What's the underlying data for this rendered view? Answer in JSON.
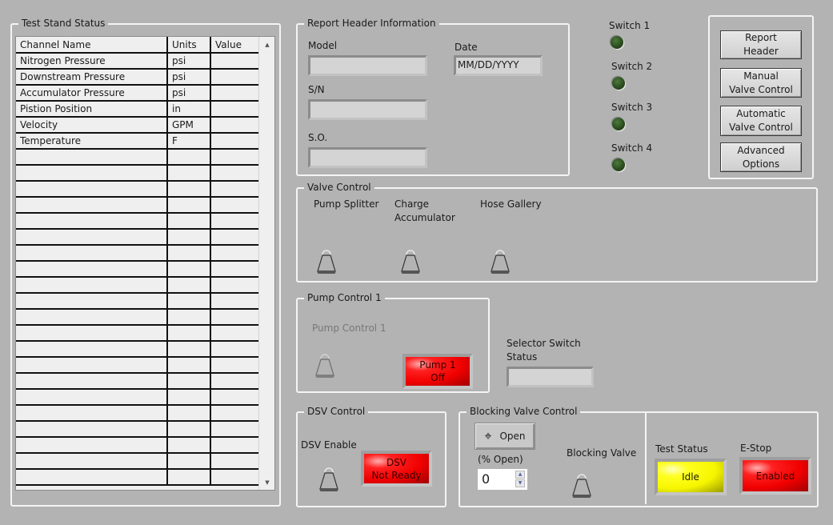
{
  "test_stand_status": {
    "title": "Test Stand Status",
    "columns": [
      "Channel Name",
      "Units",
      "Value"
    ],
    "rows": [
      [
        "Nitrogen Pressure",
        "psi",
        ""
      ],
      [
        "Downstream Pressure",
        "psi",
        ""
      ],
      [
        "Accumulator Pressure",
        "psi",
        ""
      ],
      [
        "Pistion Position",
        "in",
        ""
      ],
      [
        "Velocity",
        "GPM",
        ""
      ],
      [
        "Temperature",
        "F",
        ""
      ]
    ],
    "empty_rows": 21,
    "scroll_up_icon": "triangle-up-icon",
    "scroll_down_icon": "triangle-down-icon"
  },
  "report_header": {
    "title": "Report Header Information",
    "model_label": "Model",
    "model_value": "",
    "sn_label": "S/N",
    "sn_value": "",
    "so_label": "S.O.",
    "so_value": "",
    "date_label": "Date",
    "date_value": "MM/DD/YYYY"
  },
  "switches": [
    {
      "label": "Switch 1",
      "state": "off",
      "color": "#2b4d1f"
    },
    {
      "label": "Switch 2",
      "state": "off",
      "color": "#2b4d1f"
    },
    {
      "label": "Switch 3",
      "state": "off",
      "color": "#2b4d1f"
    },
    {
      "label": "Switch 4",
      "state": "off",
      "color": "#2b4d1f"
    }
  ],
  "nav_buttons": {
    "report_header": [
      "Report",
      "Header"
    ],
    "manual_valve": [
      "Manual",
      "Valve Control"
    ],
    "automatic_valve": [
      "Automatic",
      "Valve Control"
    ],
    "advanced": [
      "Advanced",
      "Options"
    ]
  },
  "valve_control": {
    "title": "Valve Control",
    "pump_splitter": "Pump Splitter",
    "charge_accumulator": [
      "Charge",
      "Accumulator"
    ],
    "hose_gallery": "Hose Gallery"
  },
  "pump_control": {
    "title": "Pump Control 1",
    "switch_label": "Pump Control 1",
    "indicator": [
      "Pump 1",
      "Off"
    ],
    "indicator_color": "#f00000"
  },
  "selector_switch": {
    "label": [
      "Selector Switch",
      "Status"
    ],
    "value": ""
  },
  "dsv_control": {
    "title": "DSV Control",
    "enable_label": "DSV Enable",
    "indicator": [
      "DSV",
      "Not Ready"
    ],
    "indicator_color": "#f00000"
  },
  "blocking_valve": {
    "title": "Blocking Valve Control",
    "open_button": "Open",
    "open_icon": "crosshair-icon",
    "percent_label": "(% Open)",
    "percent_value": "0",
    "valve_label": "Blocking Valve"
  },
  "status": {
    "test_status_label": "Test Status",
    "test_status_value": "Idle",
    "test_status_color": "#f6f600",
    "estop_label": "E-Stop",
    "estop_value": "Enabled",
    "estop_color": "#f00000"
  }
}
